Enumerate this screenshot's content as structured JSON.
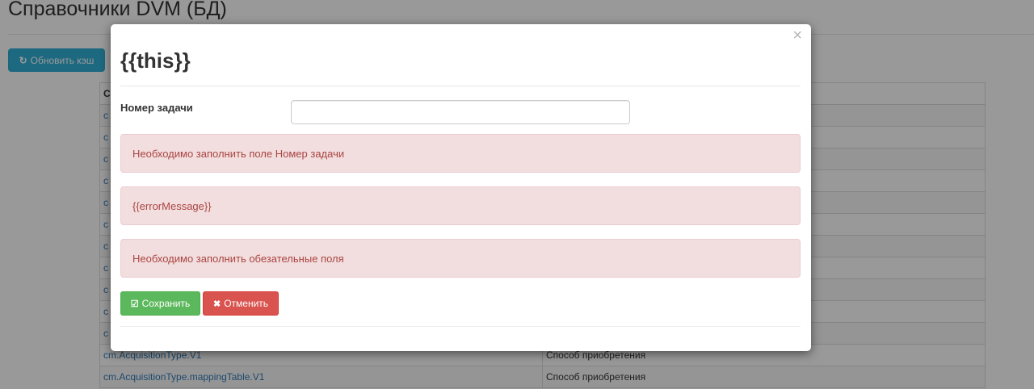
{
  "page": {
    "title": "Справочники DVM (БД)",
    "refresh_button": {
      "icon": "refresh-icon",
      "glyph": "↻",
      "label": "Обновить кэш"
    }
  },
  "table": {
    "header": [
      "С",
      ""
    ],
    "rows": [
      {
        "code": "с",
        "description": ""
      },
      {
        "code": "с",
        "description": ""
      },
      {
        "code": "с",
        "description": ""
      },
      {
        "code": "с",
        "description": ""
      },
      {
        "code": "с",
        "description": ""
      },
      {
        "code": "с",
        "description": ""
      },
      {
        "code": "с",
        "description": ""
      },
      {
        "code": "с",
        "description": ""
      },
      {
        "code": "с",
        "description": ""
      },
      {
        "code": "с",
        "description": ""
      },
      {
        "code": "с",
        "description": ""
      },
      {
        "code": "cm.AcquisitionType.V1",
        "description": "Способ приобретения"
      },
      {
        "code": "cm.AcquisitionType.mappingTable.V1",
        "description": "Способ приобретения"
      }
    ]
  },
  "modal": {
    "title": "{{this}}",
    "close_glyph": "×",
    "field": {
      "label": "Номер задачи",
      "value": "",
      "placeholder": ""
    },
    "alerts": [
      "Необходимо заполнить поле Номер задачи",
      "{{errorMessage}}",
      "Необходимо заполнить обезательные поля"
    ],
    "save_button": {
      "icon": "check-square-icon",
      "glyph": "☑",
      "label": "Сохранить"
    },
    "cancel_button": {
      "icon": "close-icon",
      "glyph": "✖",
      "label": "Отменить"
    }
  },
  "colors": {
    "info": "#31b0d5",
    "success": "#5cb85c",
    "danger": "#d9534f",
    "alert_bg": "#f2dede",
    "alert_text": "#a94442",
    "link": "#337ab7"
  }
}
